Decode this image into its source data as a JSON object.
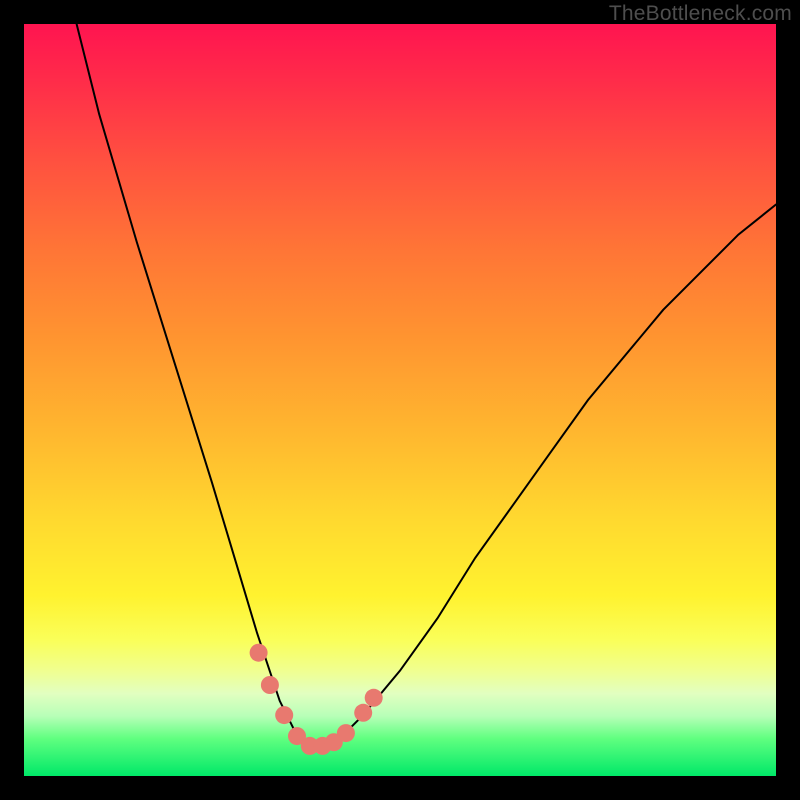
{
  "watermark": "TheBottleneck.com",
  "chart_data": {
    "type": "line",
    "title": "",
    "xlabel": "",
    "ylabel": "",
    "xlim": [
      0,
      100
    ],
    "ylim": [
      0,
      100
    ],
    "note": "V-shaped bottleneck curve over vertical rainbow gradient (red=high bottleneck at top, green=low bottleneck at bottom). Values are percentages read off the y-axis height (0 at bottom, 100 at top).",
    "series": [
      {
        "name": "bottleneck-curve",
        "x": [
          7,
          10,
          15,
          20,
          25,
          28,
          31,
          34,
          36,
          38,
          40,
          42,
          45,
          50,
          55,
          60,
          65,
          70,
          75,
          80,
          85,
          90,
          95,
          100
        ],
        "y": [
          100,
          88,
          71,
          55,
          39,
          29,
          19,
          10,
          6,
          4,
          4,
          5,
          8,
          14,
          21,
          29,
          36,
          43,
          50,
          56,
          62,
          67,
          72,
          76
        ]
      }
    ],
    "markers": [
      {
        "x": 31.2,
        "y": 16.4
      },
      {
        "x": 32.7,
        "y": 12.1
      },
      {
        "x": 34.6,
        "y": 8.1
      },
      {
        "x": 36.3,
        "y": 5.3
      },
      {
        "x": 38.0,
        "y": 4.0
      },
      {
        "x": 39.7,
        "y": 4.0
      },
      {
        "x": 41.2,
        "y": 4.5
      },
      {
        "x": 42.8,
        "y": 5.7
      },
      {
        "x": 45.1,
        "y": 8.4
      },
      {
        "x": 46.5,
        "y": 10.4
      }
    ]
  }
}
